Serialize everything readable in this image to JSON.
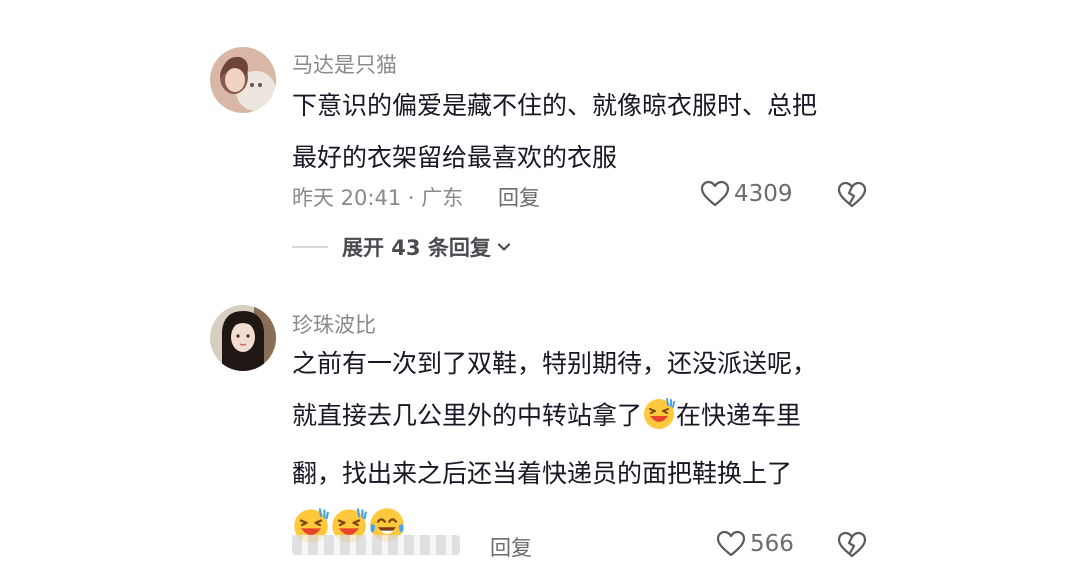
{
  "comments": [
    {
      "username": "马达是只猫",
      "lines": [
        "下意识的偏爱是藏不住的、就像晾衣服时、总把",
        "最好的衣架留给最喜欢的衣服"
      ],
      "meta": "昨天 20:41 · 广东",
      "reply_label": "回复",
      "like_count": "4309",
      "expand_label": "展开 43 条回复"
    },
    {
      "username": "珍珠波比",
      "lines": [
        "之前有一次到了双鞋，特别期待，还没派送呢，",
        "就直接去几公里外的中转站拿了",
        "在快递车里",
        "翻，找出来之后还当着快递员的面把鞋换上了"
      ],
      "reply_label": "回复",
      "like_count": "566"
    }
  ],
  "icons": {
    "like": "heart-outline-icon",
    "dislike": "broken-heart-icon",
    "expand": "chevron-down-icon",
    "emoji": [
      "laughing-sweat-emoji",
      "laughing-sweat-emoji",
      "laughing-sweat-emoji",
      "tears-of-joy-emoji"
    ]
  },
  "colors": {
    "text": "#161823",
    "secondary": "#8a8a8e",
    "emoji_face": "#ffc83d"
  }
}
